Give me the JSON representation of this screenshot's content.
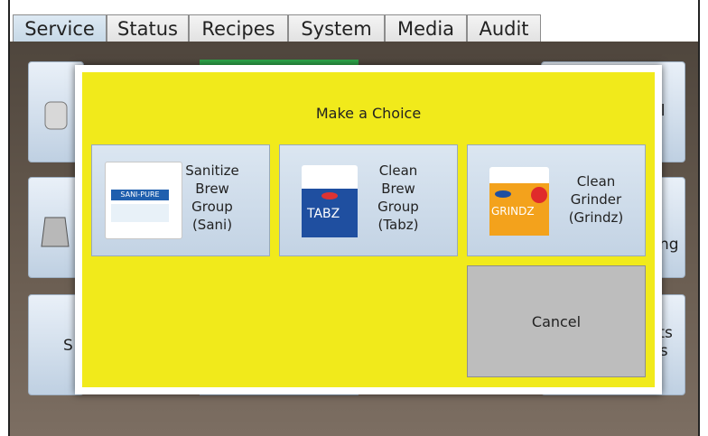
{
  "tabs": [
    {
      "label": "Service",
      "active": true
    },
    {
      "label": "Status",
      "active": false
    },
    {
      "label": "Recipes",
      "active": false
    },
    {
      "label": "System",
      "active": false
    },
    {
      "label": "Media",
      "active": false
    },
    {
      "label": "Audit",
      "active": false
    }
  ],
  "background_tiles": {
    "tile_right_1_fragment": "il",
    "tile_right_2_fragment": "ng",
    "tile_left_3_fragment": "S",
    "tile_right_3_fragment_a": "cts",
    "tile_right_3_fragment_b": "ls"
  },
  "dialog": {
    "title": "Make a Choice",
    "choices": [
      {
        "line1": "Sanitize",
        "line2": "Brew",
        "line3": "Group",
        "line4": "(Sani)",
        "product_text": "SANI-PURE"
      },
      {
        "line1": "Clean",
        "line2": "Brew",
        "line3": "Group",
        "line4": "(Tabz)",
        "product_text": "TABZ"
      },
      {
        "line1": "Clean",
        "line2": "Grinder",
        "line3": "(Grindz)",
        "line4": "",
        "product_text": "GRINDZ"
      }
    ],
    "cancel_label": "Cancel"
  },
  "colors": {
    "dialog_background": "#f1ea1b",
    "tab_active": "#c7d9e7",
    "cancel_background": "#bdbdbd"
  }
}
